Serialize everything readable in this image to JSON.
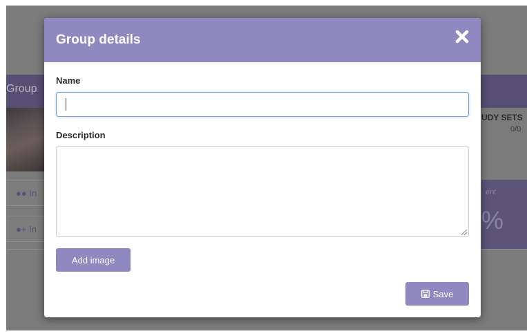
{
  "background": {
    "group_label": "Group",
    "button_1_label": "In",
    "button_2_label": "In",
    "study_sets_label": "UDY SETS",
    "study_sets_count": "0/0",
    "stat_label": "ent",
    "stat_value": "%"
  },
  "modal": {
    "title": "Group details",
    "close_icon": "close-icon",
    "name_label": "Name",
    "name_value": "",
    "description_label": "Description",
    "description_value": "",
    "add_image_label": "Add image",
    "save_label": "Save",
    "save_icon": "floppy-disk-icon"
  },
  "colors": {
    "accent": "#9088c0",
    "overlay": "#7b7b7b",
    "focus_border": "#6aa6dd"
  }
}
